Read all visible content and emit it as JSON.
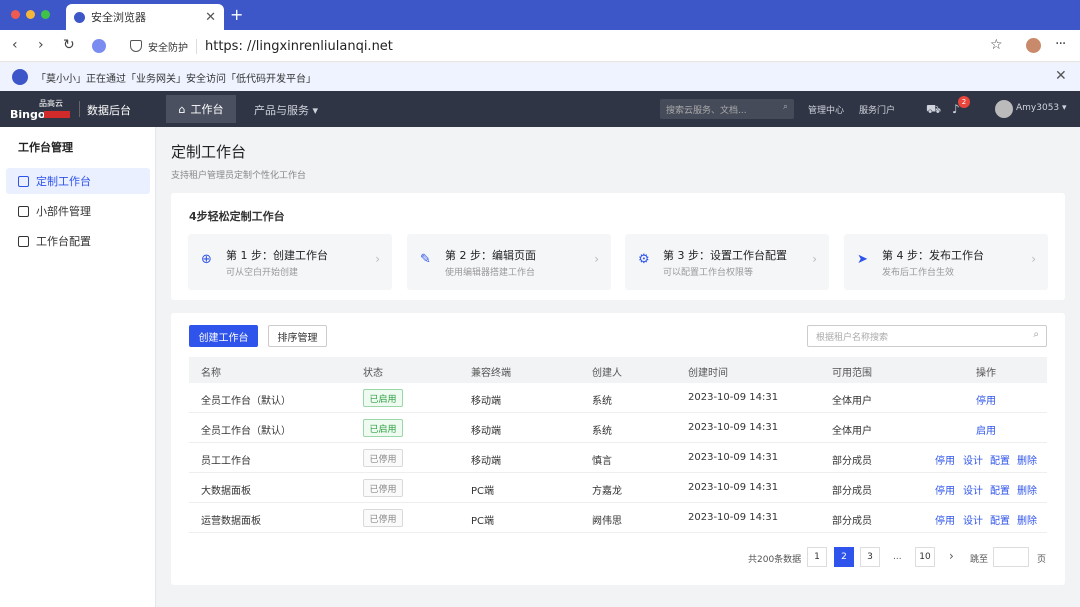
{
  "browser": {
    "tab_title": "安全浏览器",
    "tab_close": "✕",
    "new_tab": "+",
    "secure_label": "安全防护",
    "url": "https: //lingxinrenliulanqi.net",
    "notice": "「莫小小」正在通过「业务网关」安全访问「低代码开发平台」",
    "notice_close": "✕",
    "colors": {
      "tabbar": "#3d57c9",
      "dot_red": "#f05b4f",
      "dot_yellow": "#f5b73b",
      "dot_green": "#3fc24a"
    }
  },
  "header": {
    "brand_cn": "品高云",
    "brand_en": "Bingo",
    "console": "数据后台",
    "workbench": "工作台",
    "products": "产品与服务 ▾",
    "search_placeholder": "搜索云服务、文档...",
    "links": [
      "管理中心",
      "服务门户"
    ],
    "badge_count": "2",
    "user": "Amy3053 ▾"
  },
  "sidebar": {
    "title": "工作台管理",
    "items": [
      {
        "label": "定制工作台",
        "active": true
      },
      {
        "label": "小部件管理",
        "active": false
      },
      {
        "label": "工作台配置",
        "active": false
      }
    ]
  },
  "main": {
    "title": "定制工作台",
    "subtitle": "支持租户管理员定制个性化工作台",
    "steps_title": "4步轻松定制工作台",
    "steps": [
      {
        "icon": "⊕",
        "title": "第 1 步：创建工作台",
        "desc": "可从空白开始创建"
      },
      {
        "icon": "✎",
        "title": "第 2 步：编辑页面",
        "desc": "使用编辑器搭建工作台"
      },
      {
        "icon": "⚙",
        "title": "第 3 步：设置工作台配置",
        "desc": "可以配置工作台权限等"
      },
      {
        "icon": "➤",
        "title": "第 4 步：发布工作台",
        "desc": "发布后工作台生效"
      }
    ],
    "btn_create": "创建工作台",
    "btn_sort": "排序管理",
    "search_placeholder": "根据租户名称搜索",
    "columns": [
      "名称",
      "状态",
      "兼容终端",
      "创建人",
      "创建时间",
      "可用范围",
      "操作"
    ],
    "rows": [
      {
        "name": "全员工作台（默认）",
        "status": "已启用",
        "on": true,
        "terminal": "移动端",
        "creator": "系统",
        "time": "2023-10-09 14:31",
        "scope": "全体用户",
        "ops": [
          "停用"
        ]
      },
      {
        "name": "全员工作台（默认）",
        "status": "已启用",
        "on": true,
        "terminal": "移动端",
        "creator": "系统",
        "time": "2023-10-09 14:31",
        "scope": "全体用户",
        "ops": [
          "启用"
        ]
      },
      {
        "name": "员工工作台",
        "status": "已停用",
        "on": false,
        "terminal": "移动端",
        "creator": "慎言",
        "time": "2023-10-09 14:31",
        "scope": "部分成员",
        "ops": [
          "停用",
          "设计",
          "配置",
          "删除"
        ]
      },
      {
        "name": "大数据面板",
        "status": "已停用",
        "on": false,
        "terminal": "PC端",
        "creator": "方嘉龙",
        "time": "2023-10-09 14:31",
        "scope": "部分成员",
        "ops": [
          "停用",
          "设计",
          "配置",
          "删除"
        ]
      },
      {
        "name": "运营数据面板",
        "status": "已停用",
        "on": false,
        "terminal": "PC端",
        "creator": "阙伟思",
        "time": "2023-10-09 14:31",
        "scope": "部分成员",
        "ops": [
          "停用",
          "设计",
          "配置",
          "删除"
        ]
      }
    ],
    "pager": {
      "total": "共200条数据",
      "pages": [
        "1",
        "2",
        "3",
        "...",
        "10"
      ],
      "active": "2",
      "next": "›",
      "jump_label": "跳至",
      "page_unit": "页"
    }
  }
}
